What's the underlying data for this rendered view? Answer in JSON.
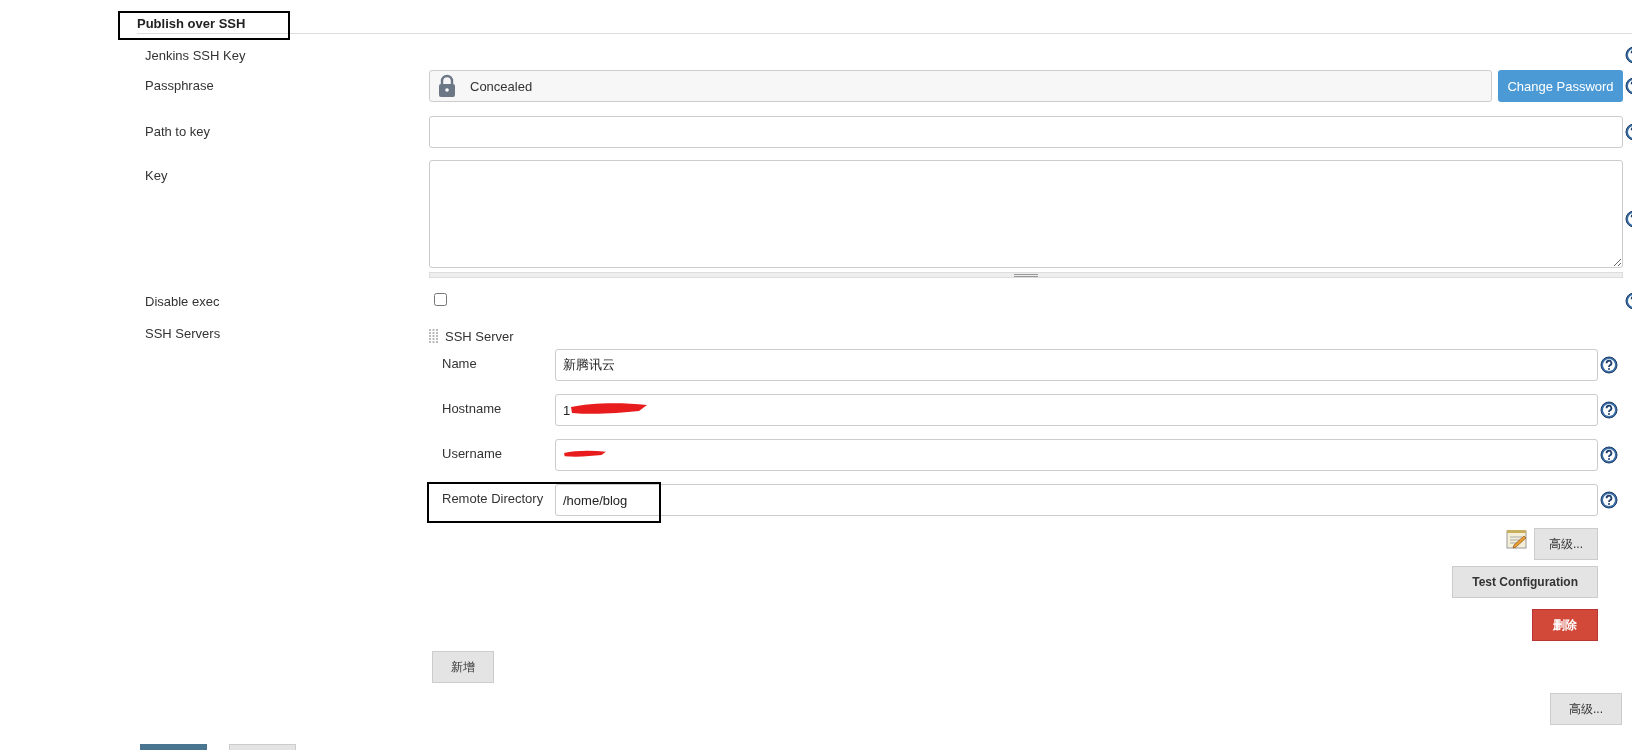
{
  "section": {
    "title": "Publish over SSH",
    "highlighted": true
  },
  "fields": [
    {
      "kind": "label",
      "label": "Jenkins SSH Key"
    },
    {
      "kind": "secret",
      "label": "Passphrase",
      "value": "Concealed",
      "button": "Change Password"
    },
    {
      "kind": "text",
      "label": "Path to key"
    },
    {
      "kind": "textarea",
      "label": "Key"
    },
    {
      "kind": "checkbox",
      "label": "Disable exec",
      "checked": false
    }
  ],
  "ssh_servers": {
    "label": "SSH Servers",
    "servers": [
      {
        "title": "SSH Server",
        "fields": [
          {
            "label": "Name",
            "value": "新腾讯云",
            "redacted": false,
            "highlighted": false
          },
          {
            "label": "Hostname",
            "value": "1",
            "redacted": true,
            "highlighted": false
          },
          {
            "label": "Username",
            "redacted": true,
            "highlighted": false
          },
          {
            "label": "Remote Directory",
            "value": "/home/blog",
            "redacted": false,
            "highlighted": true
          }
        ],
        "advanced_button": "高级...",
        "test_button": "Test Configuration",
        "delete_button": "删除"
      }
    ],
    "add_button": "新增"
  },
  "advanced_button": "高级...",
  "footer_buttons": [
    {
      "kind": "primary"
    },
    {
      "kind": "secondary"
    }
  ]
}
